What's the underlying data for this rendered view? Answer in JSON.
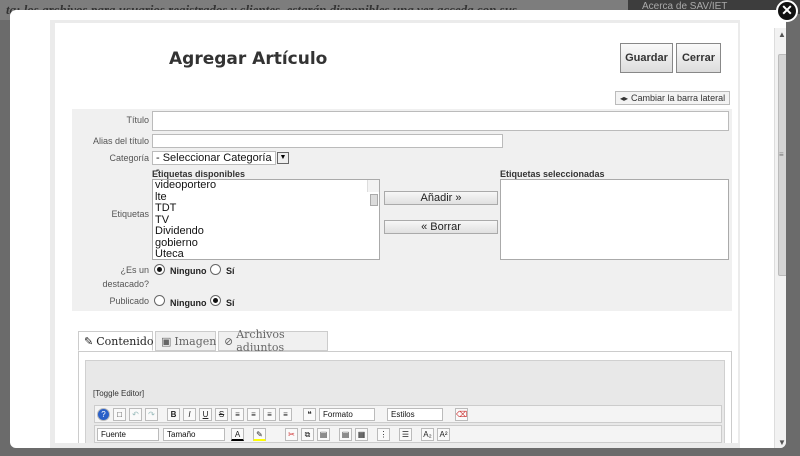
{
  "background": {
    "top_text": "ta: los archivos para usuarios registrados y clientes, estarán disponibles una vez acceda con sus",
    "right_text": "Acerca de SAV/IET"
  },
  "header": {
    "title": "Agregar Artículo",
    "save_label": "Guardar",
    "close_label": "Cerrar",
    "toggle_sidebar_label": "Cambiar la barra lateral"
  },
  "form": {
    "title_label": "Título",
    "title_value": "",
    "alias_label": "Alias del título",
    "alias_value": "",
    "category_label": "Categoría",
    "category_value": "- Seleccionar Categoría -",
    "tags_label": "Etiquetas",
    "available_tags_label": "Etiquetas disponibles",
    "selected_tags_label": "Etiquetas seleccionadas",
    "available_tags": [
      "videoportero",
      "lte",
      "TDT",
      "TV",
      "Dividendo",
      "gobierno",
      "Uteca"
    ],
    "add_button": "Añadir »",
    "remove_button": "« Borrar",
    "featured_label_1": "¿Es un",
    "featured_label_2": "destacado?",
    "featured_option_none": "Ninguno",
    "featured_option_yes": "Sí",
    "featured_value": "Ninguno",
    "published_label": "Publicado",
    "published_option_none": "Ninguno",
    "published_option_yes": "Sí",
    "published_value": "Sí"
  },
  "tabs": [
    {
      "label": "Contenido",
      "icon": "edit-icon",
      "active": true
    },
    {
      "label": "Imagen",
      "icon": "image-icon",
      "active": false
    },
    {
      "label": "Archivos adjuntos",
      "icon": "paperclip-icon",
      "active": false
    }
  ],
  "editor": {
    "toggle_label": "[Toggle Editor]",
    "format_value": "Formato",
    "styles_value": "Estilos",
    "font_value": "Fuente",
    "size_value": "Tamaño"
  }
}
